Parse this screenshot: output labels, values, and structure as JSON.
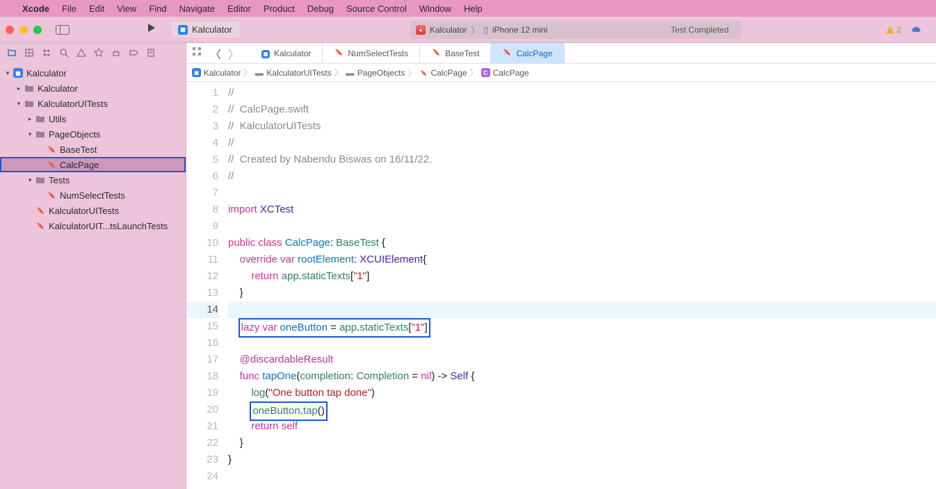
{
  "menubar": {
    "app": "Xcode",
    "items": [
      "File",
      "Edit",
      "View",
      "Find",
      "Navigate",
      "Editor",
      "Product",
      "Debug",
      "Source Control",
      "Window",
      "Help"
    ]
  },
  "toolbar": {
    "project": "Kalculator",
    "scheme": "Kalculator",
    "device": "iPhone 12 mini",
    "status": "Test Completed",
    "warning_count": "2"
  },
  "navigator": {
    "root": "Kalculator",
    "items": [
      {
        "label": "Kalculator",
        "depth": 1,
        "icon": "folder",
        "disclosure": "right"
      },
      {
        "label": "KalculatorUITests",
        "depth": 1,
        "icon": "folder",
        "disclosure": "down"
      },
      {
        "label": "Utils",
        "depth": 2,
        "icon": "folder",
        "disclosure": "right"
      },
      {
        "label": "PageObjects",
        "depth": 2,
        "icon": "folder",
        "disclosure": "down"
      },
      {
        "label": "BaseTest",
        "depth": 3,
        "icon": "swift"
      },
      {
        "label": "CalcPage",
        "depth": 3,
        "icon": "swift",
        "selected": true,
        "boxed": true
      },
      {
        "label": "Tests",
        "depth": 2,
        "icon": "folder",
        "disclosure": "down"
      },
      {
        "label": "NumSelectTests",
        "depth": 3,
        "icon": "swift"
      },
      {
        "label": "KalculatorUITests",
        "depth": 2,
        "icon": "swift"
      },
      {
        "label": "KalculatorUIT...tsLaunchTests",
        "depth": 2,
        "icon": "swift"
      }
    ]
  },
  "tabs": [
    {
      "label": "Kalculator",
      "icon": "project"
    },
    {
      "label": "NumSelectTests",
      "icon": "swift"
    },
    {
      "label": "BaseTest",
      "icon": "swift"
    },
    {
      "label": "CalcPage",
      "icon": "swift",
      "active": true
    }
  ],
  "jumpbar": [
    "Kalculator",
    "KalculatorUITests",
    "PageObjects",
    "CalcPage",
    "CalcPage"
  ],
  "code": {
    "lines": [
      {
        "n": 1,
        "t": "comment",
        "text": "//"
      },
      {
        "n": 2,
        "t": "comment",
        "text": "//  CalcPage.swift"
      },
      {
        "n": 3,
        "t": "comment",
        "text": "//  KalculatorUITests"
      },
      {
        "n": 4,
        "t": "comment",
        "text": "//"
      },
      {
        "n": 5,
        "t": "comment",
        "text": "//  Created by Nabendu Biswas on 16/11/22."
      },
      {
        "n": 6,
        "t": "comment",
        "text": "//"
      },
      {
        "n": 7,
        "t": "blank"
      },
      {
        "n": 8,
        "t": "import"
      },
      {
        "n": 9,
        "t": "blank"
      },
      {
        "n": 10,
        "t": "classdecl"
      },
      {
        "n": 11,
        "t": "override"
      },
      {
        "n": 12,
        "t": "return1"
      },
      {
        "n": 13,
        "t": "closebrace",
        "indent": 4
      },
      {
        "n": 14,
        "t": "blank",
        "current": true
      },
      {
        "n": 15,
        "t": "lazyvar",
        "boxed": true
      },
      {
        "n": 16,
        "t": "blank"
      },
      {
        "n": 17,
        "t": "discardable"
      },
      {
        "n": 18,
        "t": "funcdecl"
      },
      {
        "n": 19,
        "t": "logline"
      },
      {
        "n": 20,
        "t": "tapline",
        "boxed": true
      },
      {
        "n": 21,
        "t": "returnself"
      },
      {
        "n": 22,
        "t": "closebrace",
        "indent": 4
      },
      {
        "n": 23,
        "t": "closebrace",
        "indent": 0
      },
      {
        "n": 24,
        "t": "blank"
      }
    ],
    "strings": {
      "import_kw": "import",
      "xctest": "XCTest",
      "public": "public",
      "class": "class",
      "calcpage": "CalcPage",
      "basetest": "BaseTest",
      "override": "override",
      "var": "var",
      "rootElement": "rootElement",
      "xcuielement": "XCUIElement",
      "return": "return",
      "app": "app",
      "staticTexts": "staticTexts",
      "one": "\"1\"",
      "lazy": "lazy",
      "oneButton": "oneButton",
      "discardable": "@discardableResult",
      "func": "func",
      "tapOne": "tapOne",
      "completion_p": "completion",
      "completion_t": "Completion",
      "nil": "nil",
      "self_t": "Self",
      "log": "log",
      "logmsg": "\"One button tap done\"",
      "tap": "tap",
      "self": "self"
    }
  }
}
